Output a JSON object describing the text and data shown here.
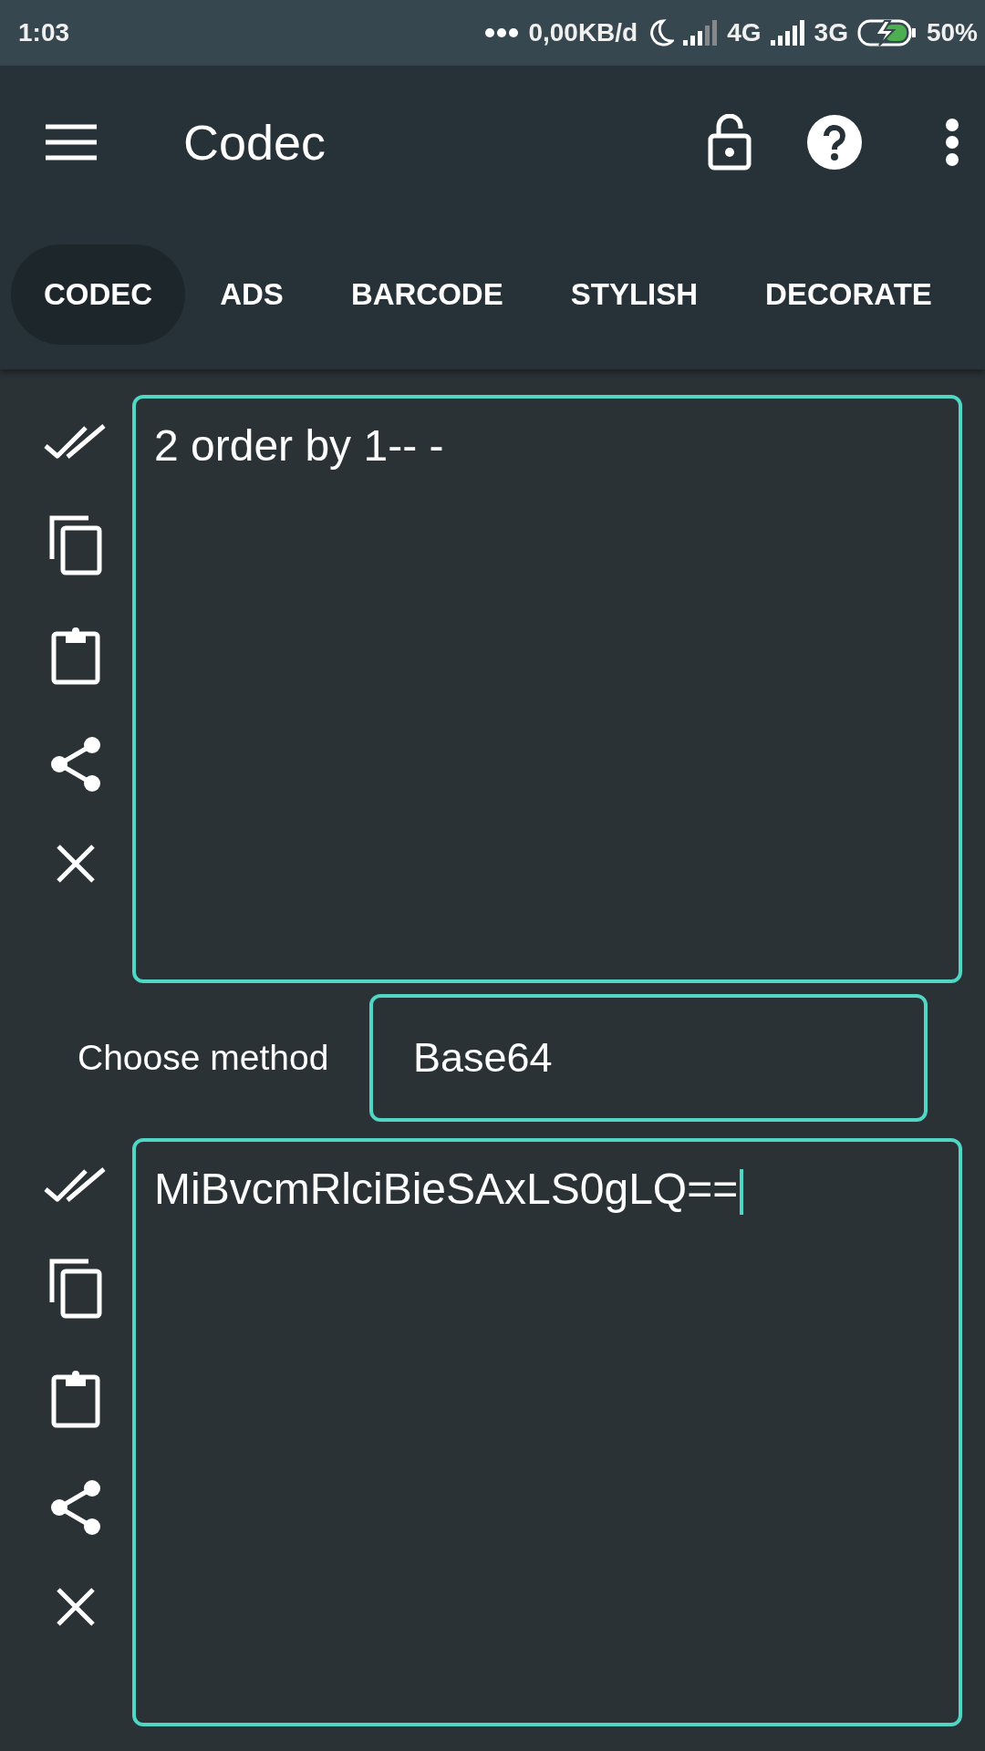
{
  "status_bar": {
    "time": "1:03",
    "data_rate": "0,00KB/d",
    "network_1": "4G",
    "network_2": "3G",
    "battery": "50%"
  },
  "app_bar": {
    "title": "Codec"
  },
  "tabs": [
    {
      "label": "CODEC",
      "selected": true
    },
    {
      "label": "ADS",
      "selected": false
    },
    {
      "label": "BARCODE",
      "selected": false
    },
    {
      "label": "STYLISH",
      "selected": false
    },
    {
      "label": "DECORATE",
      "selected": false
    }
  ],
  "input_box": {
    "value": "2 order by 1-- -",
    "focused": false
  },
  "method": {
    "label": "Choose method",
    "value": "Base64"
  },
  "output_box": {
    "value": "MiBvcmRlciBieSAxLS0gLQ==",
    "focused": true
  }
}
